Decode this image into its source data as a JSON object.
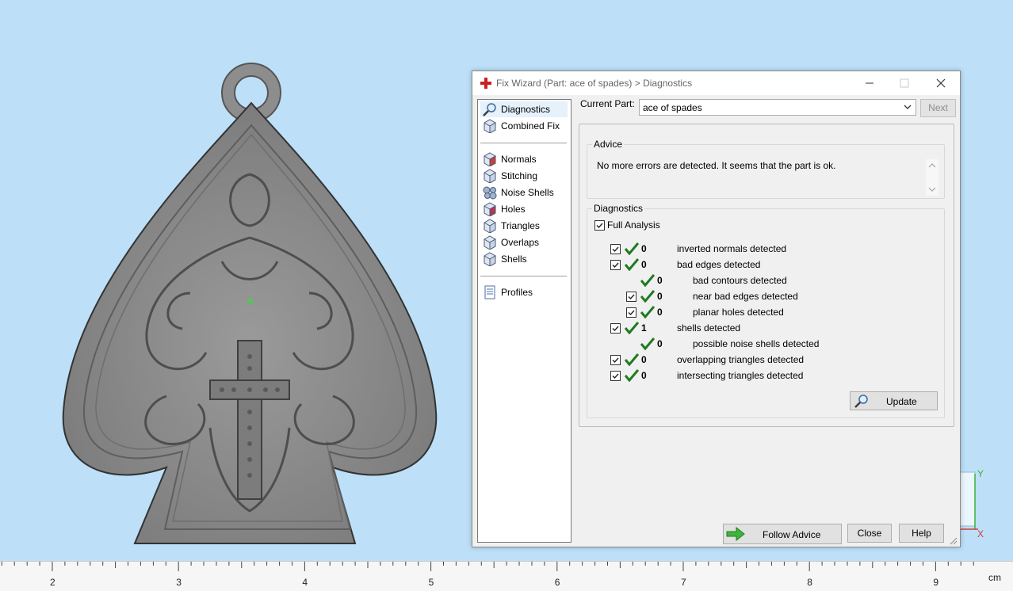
{
  "dialog": {
    "title": "Fix Wizard (Part: ace of spades) > Diagnostics",
    "current_part_label": "Current Part:",
    "current_part_value": "ace of spades",
    "next_label": "Next",
    "advice_legend": "Advice",
    "advice_text": "No more errors are detected. It seems that the part is ok.",
    "diagnostics_legend": "Diagnostics",
    "full_analysis_label": "Full Analysis",
    "full_analysis_checked": true,
    "rows": [
      {
        "count": "0",
        "label": "inverted normals detected",
        "checkbox": true,
        "checked": true,
        "indent": 0
      },
      {
        "count": "0",
        "label": "bad edges detected",
        "checkbox": true,
        "checked": true,
        "indent": 0
      },
      {
        "count": "0",
        "label": "bad contours detected",
        "checkbox": false,
        "checked": false,
        "indent": 1
      },
      {
        "count": "0",
        "label": "near bad edges detected",
        "checkbox": true,
        "checked": true,
        "indent": 1
      },
      {
        "count": "0",
        "label": "planar holes detected",
        "checkbox": true,
        "checked": true,
        "indent": 1
      },
      {
        "count": "1",
        "label": "shells detected",
        "checkbox": true,
        "checked": true,
        "indent": 0
      },
      {
        "count": "0",
        "label": "possible noise shells detected",
        "checkbox": false,
        "checked": false,
        "indent": 1
      },
      {
        "count": "0",
        "label": "overlapping triangles detected",
        "checkbox": true,
        "checked": true,
        "indent": 0
      },
      {
        "count": "0",
        "label": "intersecting triangles detected",
        "checkbox": true,
        "checked": true,
        "indent": 0
      }
    ],
    "update_label": "Update",
    "follow_advice_label": "Follow Advice",
    "close_label": "Close",
    "help_label": "Help"
  },
  "nav": {
    "group1": [
      {
        "label": "Diagnostics",
        "icon": "magnifier-icon",
        "selected": true
      },
      {
        "label": "Combined Fix",
        "icon": "cube-icon",
        "selected": false
      }
    ],
    "group2": [
      {
        "label": "Normals",
        "icon": "normals-cube-icon"
      },
      {
        "label": "Stitching",
        "icon": "stitching-cube-icon"
      },
      {
        "label": "Noise Shells",
        "icon": "noise-shells-icon"
      },
      {
        "label": "Holes",
        "icon": "holes-cube-icon"
      },
      {
        "label": "Triangles",
        "icon": "triangles-cube-icon"
      },
      {
        "label": "Overlaps",
        "icon": "overlaps-cube-icon"
      },
      {
        "label": "Shells",
        "icon": "shells-cube-icon"
      }
    ],
    "group3": [
      {
        "label": "Profiles",
        "icon": "document-icon"
      }
    ]
  },
  "ruler": {
    "labels": [
      "2",
      "3",
      "4",
      "5",
      "6",
      "7",
      "8",
      "9"
    ],
    "unit": "cm"
  },
  "axis": {
    "y_label": "Y",
    "x_label": "X"
  },
  "colors": {
    "viewport_bg": "#bde0f8",
    "model_gray": "#8c8c8c",
    "check_green": "#1f7a1f",
    "axis_green": "#3bb23b",
    "axis_red": "#d23c3c"
  }
}
